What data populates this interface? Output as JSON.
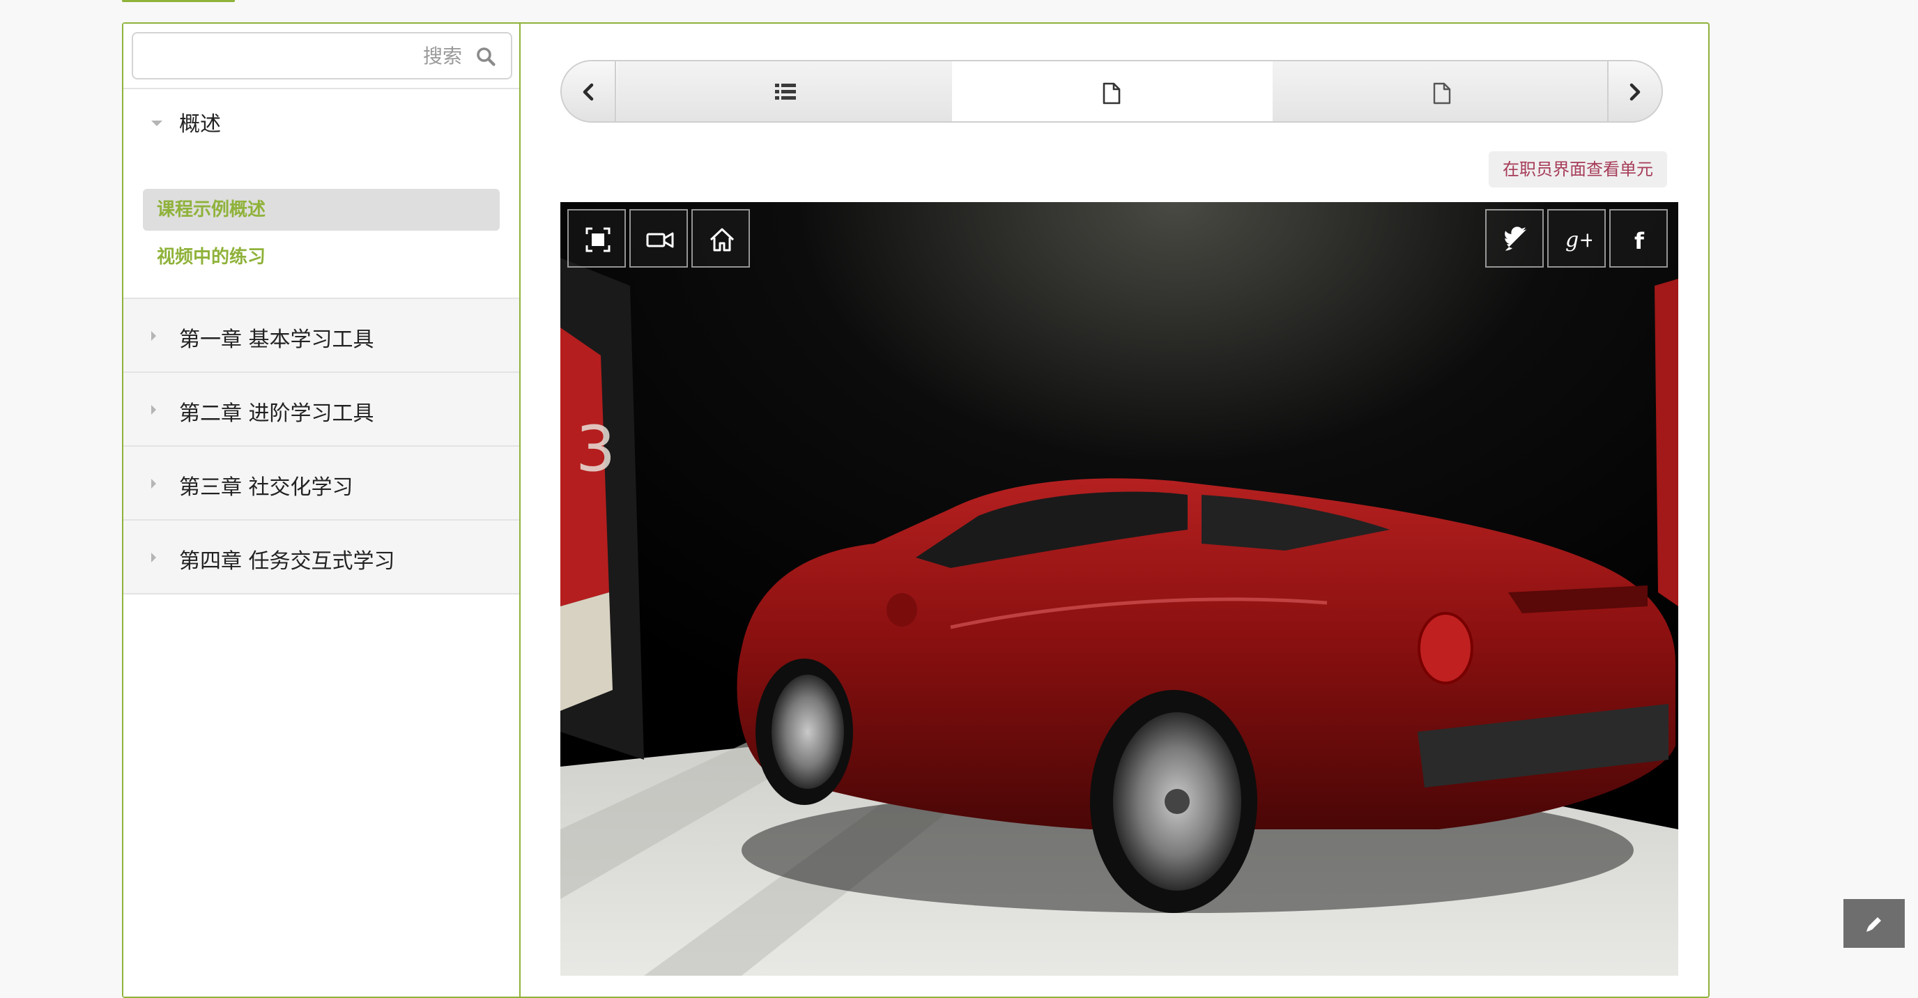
{
  "search": {
    "placeholder": "搜索"
  },
  "overview": {
    "title": "概述",
    "items": [
      {
        "label": "课程示例概述",
        "active": true
      },
      {
        "label": "视频中的练习",
        "active": false
      }
    ]
  },
  "chapters": [
    {
      "label": "第一章 基本学习工具"
    },
    {
      "label": "第二章 进阶学习工具"
    },
    {
      "label": "第三章 社交化学习"
    },
    {
      "label": "第四章 任务交互式学习"
    }
  ],
  "sequence_nav": {
    "prev_icon": "chevron-left-icon",
    "next_icon": "chevron-right-icon",
    "tabs": [
      {
        "icon": "list-icon",
        "active": false
      },
      {
        "icon": "document-icon",
        "active": true
      },
      {
        "icon": "document-icon",
        "active": false
      }
    ]
  },
  "staff_view_link": "在职员界面查看单元",
  "viewer": {
    "garage_number": "3",
    "toolbar_left": [
      "fullscreen-icon",
      "video-camera-icon",
      "home-icon"
    ],
    "toolbar_right": [
      "twitter-icon",
      "google-plus-icon",
      "facebook-icon"
    ],
    "gplus_text": "g+",
    "facebook_text": "f"
  },
  "colors": {
    "accent_green": "#8fb23a",
    "staff_link": "#a63b58",
    "car_red": "#8b1010"
  },
  "edit_icon": "pencil-icon"
}
